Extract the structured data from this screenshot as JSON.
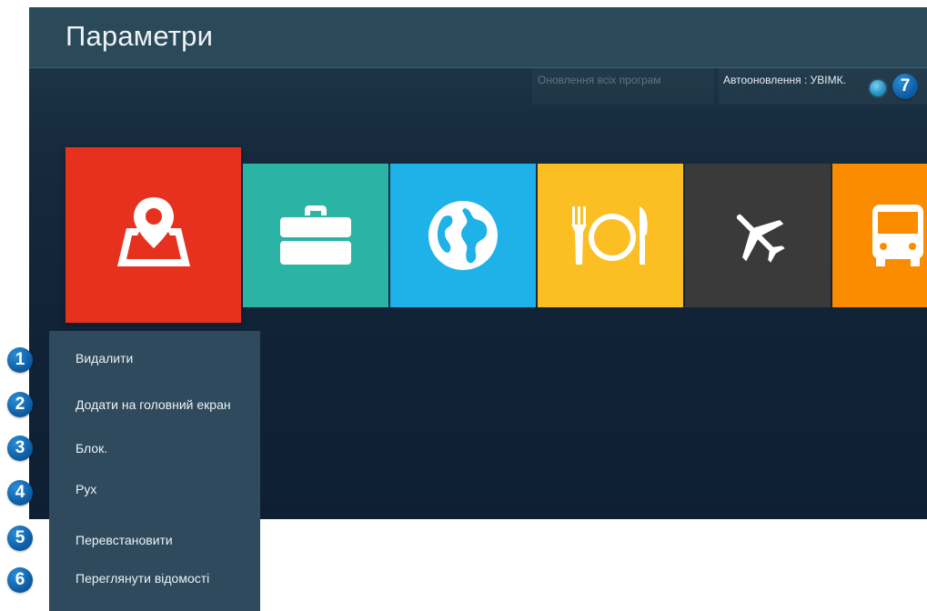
{
  "screen": {
    "title": "Параметри"
  },
  "options": {
    "update_all_label": "Оновлення всіх програм",
    "auto_update_label": "Автооновлення : УВІМК."
  },
  "tiles": [
    {
      "name": "map-tile",
      "icon": "map-pin-icon",
      "color": "#e7311f"
    },
    {
      "name": "briefcase-tile",
      "icon": "briefcase-icon",
      "color": "#2bb3a5"
    },
    {
      "name": "globe-tile",
      "icon": "globe-icon",
      "color": "#1fb2e8"
    },
    {
      "name": "dining-tile",
      "icon": "dining-icon",
      "color": "#fbbf23"
    },
    {
      "name": "airplane-tile",
      "icon": "airplane-icon",
      "color": "#3a3a3a"
    },
    {
      "name": "bus-tile",
      "icon": "bus-icon",
      "color": "#fb8c00"
    }
  ],
  "context_menu": {
    "items": [
      {
        "label": "Видалити",
        "badge": "1"
      },
      {
        "label": "Додати на головний екран",
        "badge": "2"
      },
      {
        "label": "Блок.",
        "badge": "3"
      },
      {
        "label": "Рух",
        "badge": "4"
      },
      {
        "label": "Перевстановити",
        "badge": "5"
      },
      {
        "label": "Переглянути відомості",
        "badge": "6"
      }
    ]
  },
  "callout_badge": "7",
  "colors": {
    "screen_bg": "#112337",
    "title_bar": "#2a4a5a",
    "menu_bg": "#2e4a5c",
    "badge_blue": "#0f5fa8"
  }
}
